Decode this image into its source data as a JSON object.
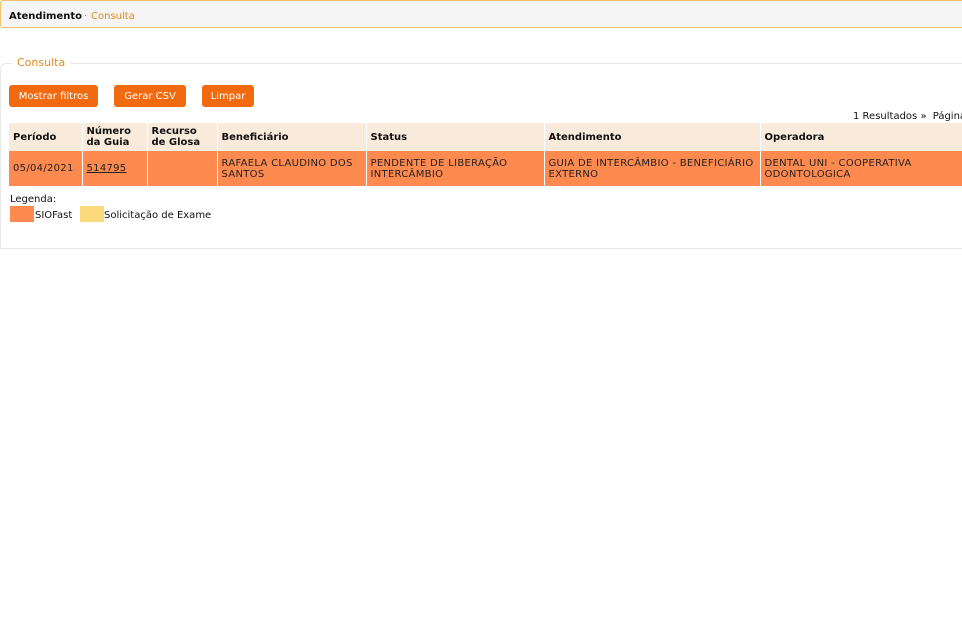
{
  "breadcrumb": {
    "home": "Atendimento",
    "separator": "·",
    "current": "Consulta"
  },
  "section": {
    "title": "Consulta"
  },
  "toolbar": {
    "show_filters": "Mostrar filtros",
    "export_csv": "Gerar CSV",
    "clear": "Limpar"
  },
  "results": {
    "count_text": "1 Resultados",
    "separator": "»",
    "page_text": "Página"
  },
  "table": {
    "headers": [
      "Período",
      "Número da Guia",
      "Recurso de Glosa",
      "Beneficiário",
      "Status",
      "Atendimento",
      "Operadora"
    ],
    "rows": [
      {
        "periodo": "05/04/2021",
        "numero_guia": "514795",
        "recurso_glosa": "",
        "beneficiario": "RAFAELA CLAUDINO DOS SANTOS",
        "status": "PENDENTE DE LIBERAÇÃO INTERCÂMBIO",
        "atendimento": "GUIA DE INTERCÂMBIO - BENEFICIÁRIO EXTERNO",
        "operadora": "DENTAL UNI - COOPERATIVA ODONTOLOGICA"
      }
    ]
  },
  "legend": {
    "title": "Legenda:",
    "items": [
      {
        "label": "SIOFast",
        "color": "#ff8a50"
      },
      {
        "label": "Solicitação de Exame",
        "color": "#fcd97a"
      }
    ]
  },
  "colors": {
    "accent": "#f26a10",
    "breadcrumb_link": "#e08a1e",
    "header_bg": "#f8ebdb",
    "row_siofast": "#ff8a50"
  }
}
